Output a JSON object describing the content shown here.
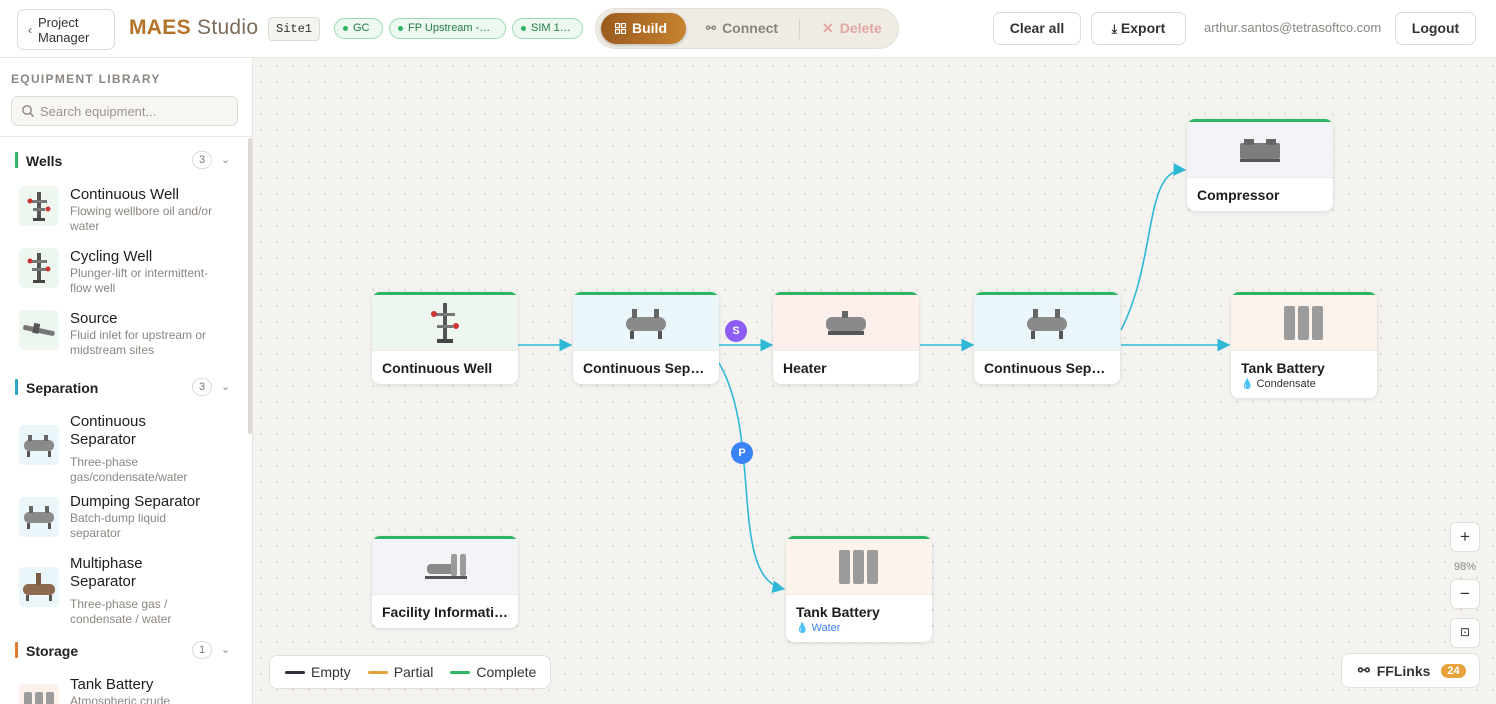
{
  "header": {
    "back_label": "Project Manager",
    "brand_main": "MAES",
    "brand_sub": "Studio",
    "site": "Site1",
    "pills": [
      "GC",
      "FP  Upstream -…",
      "SIM  1…"
    ],
    "modes": {
      "build": "Build",
      "connect": "Connect",
      "delete": "Delete"
    },
    "clear_all": "Clear all",
    "export": "Export",
    "user_email": "arthur.santos@tetrasoftco.com",
    "logout": "Logout"
  },
  "sidebar": {
    "title": "EQUIPMENT LIBRARY",
    "search_placeholder": "Search equipment...",
    "categories": [
      {
        "name": "Wells",
        "count": "3",
        "color": "#2fb463"
      },
      {
        "name": "Separation",
        "count": "3",
        "color": "#2aa7c4"
      },
      {
        "name": "Storage",
        "count": "1",
        "color": "#e07b2a"
      }
    ],
    "items": [
      {
        "label": "Continuous Well",
        "desc": "Flowing wellbore oil and/or water"
      },
      {
        "label": "Cycling Well",
        "desc": "Plunger-lift or intermittent-flow well"
      },
      {
        "label": "Source",
        "desc": "Fluid inlet for upstream or midstream sites"
      },
      {
        "label": "Continuous Separator",
        "desc": "Three-phase gas/condensate/water"
      },
      {
        "label": "Dumping Separator",
        "desc": "Batch-dump liquid separator"
      },
      {
        "label": "Multiphase Separator",
        "desc": "Three-phase gas / condensate / water"
      },
      {
        "label": "Tank Battery",
        "desc": "Atmospheric crude"
      }
    ]
  },
  "canvas": {
    "nodes": [
      {
        "label": "Continuous Well",
        "sub": ""
      },
      {
        "label": "Continuous Separator",
        "sub": ""
      },
      {
        "label": "Heater",
        "sub": ""
      },
      {
        "label": "Continuous Separator",
        "sub": ""
      },
      {
        "label": "Compressor",
        "sub": ""
      },
      {
        "label": "Tank Battery",
        "sub": "Condensate"
      },
      {
        "label": "Tank Battery",
        "sub": "Water"
      },
      {
        "label": "Facility Information",
        "sub": ""
      }
    ],
    "badges": {
      "s": "S",
      "p": "P"
    },
    "legend": [
      "Empty",
      "Partial",
      "Complete"
    ],
    "legend_colors": [
      "#2d2f3a",
      "#e6a23c",
      "#2fb463"
    ],
    "zoom_level": "98%",
    "ff_links_label": "FFLinks",
    "ff_links_count": "24"
  }
}
